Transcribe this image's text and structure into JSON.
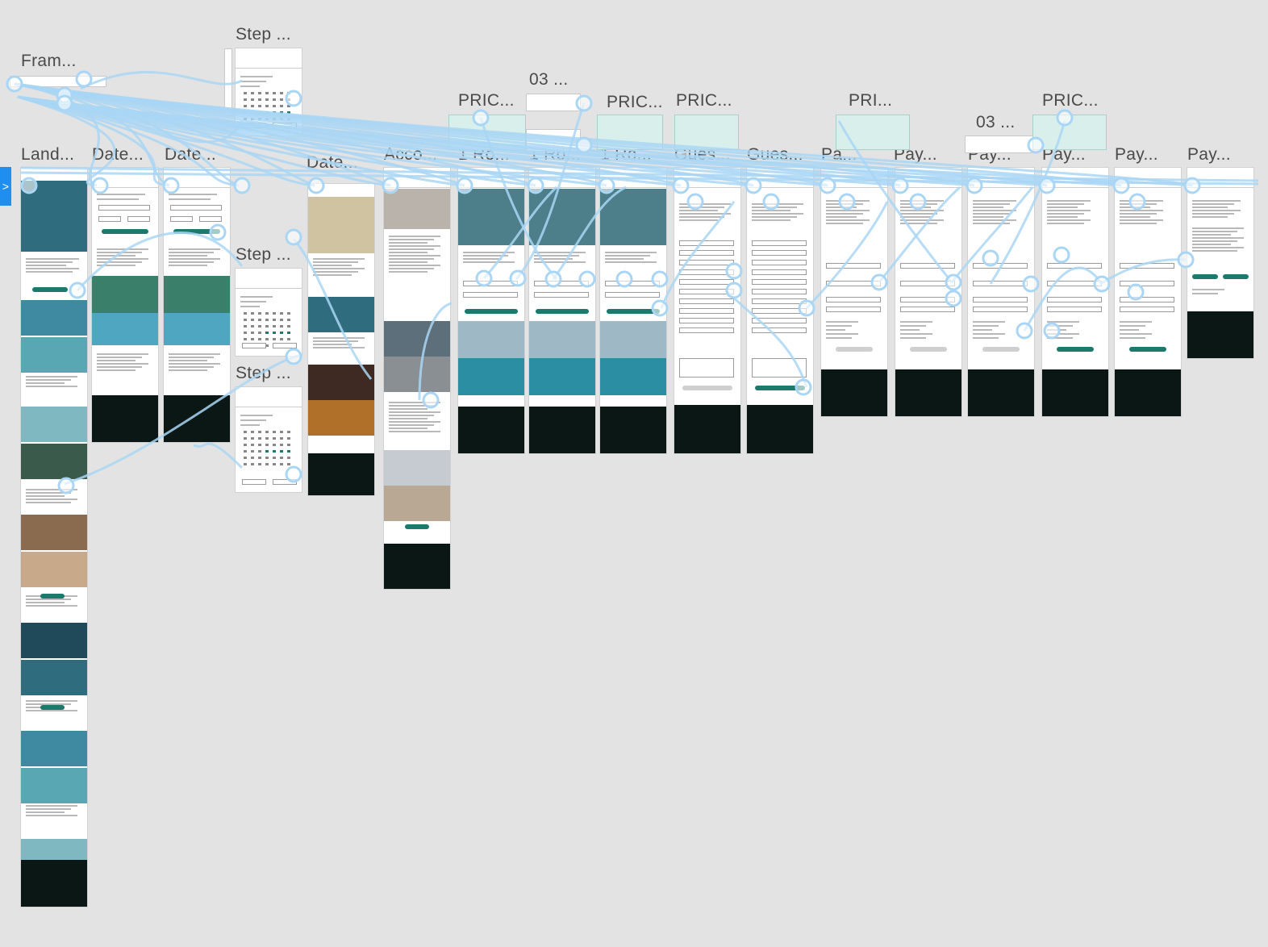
{
  "canvas": {
    "background": "#e3e3e3",
    "wire_color": "#a9d6f5",
    "accent": "#1b7a6c",
    "footer": "#0b1714"
  },
  "labels": [
    "Fram...",
    "Step ...",
    "Land...",
    "Date...",
    "Date...",
    "Step ...",
    "Date...",
    "Step ...",
    "Acco...",
    "PRIC...",
    "1 Ro...",
    "03 ...",
    "1 Ro...",
    "PRIC...",
    "1 Ro...",
    "PRIC...",
    "Gues...",
    "Gues...",
    "Pa...",
    "PRI...",
    "Pay...",
    "03 ...",
    "Pay...",
    "PRIC...",
    "Pay...",
    "Pay...",
    "Pay..."
  ],
  "frames": [
    {
      "name": "landing",
      "type": "landing"
    },
    {
      "name": "date-1",
      "type": "date"
    },
    {
      "name": "date-2",
      "type": "date"
    },
    {
      "name": "step-calendar-1",
      "type": "calendar"
    },
    {
      "name": "step-calendar-2",
      "type": "calendar"
    },
    {
      "name": "step-calendar-3",
      "type": "calendar"
    },
    {
      "name": "dining",
      "type": "dining"
    },
    {
      "name": "accommodations",
      "type": "acco"
    },
    {
      "name": "room-1",
      "type": "room"
    },
    {
      "name": "room-2",
      "type": "room"
    },
    {
      "name": "room-3",
      "type": "room"
    },
    {
      "name": "guest-1",
      "type": "guest"
    },
    {
      "name": "guest-2",
      "type": "guest"
    },
    {
      "name": "pay-1",
      "type": "pay"
    },
    {
      "name": "pay-2",
      "type": "pay"
    },
    {
      "name": "pay-3",
      "type": "pay"
    },
    {
      "name": "pay-4",
      "type": "pay"
    },
    {
      "name": "pay-5",
      "type": "pay"
    },
    {
      "name": "pay-6",
      "type": "confirm"
    }
  ]
}
